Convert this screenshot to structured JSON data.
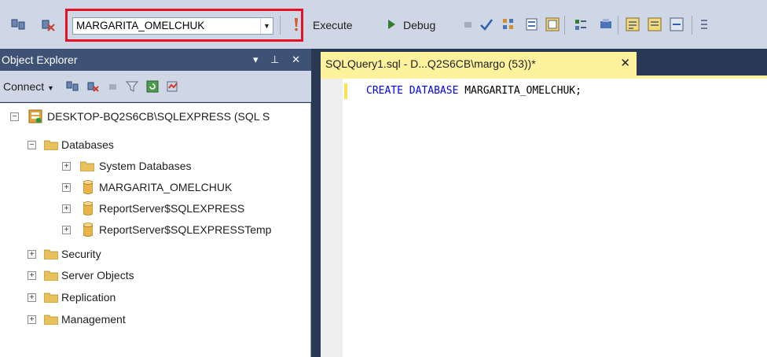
{
  "toolbar": {
    "database_selector": {
      "value": "MARGARITA_OMELCHUK"
    },
    "execute_label": "Execute",
    "debug_label": "Debug"
  },
  "object_explorer": {
    "title": "Object Explorer",
    "header_controls": "▾ ⊥ ✕",
    "connect_label": "Connect",
    "tree": [
      {
        "label": "DESKTOP-BQ2S6CB\\SQLEXPRESS (SQL S",
        "icon": "server-icon",
        "expanded": true
      },
      {
        "label": "Databases",
        "icon": "folder-icon",
        "expanded": true
      },
      {
        "label": "System Databases",
        "icon": "folder-icon",
        "expanded": false
      },
      {
        "label": "MARGARITA_OMELCHUK",
        "icon": "database-icon",
        "expanded": false
      },
      {
        "label": "ReportServer$SQLEXPRESS",
        "icon": "database-icon",
        "expanded": false
      },
      {
        "label": "ReportServer$SQLEXPRESSTemp",
        "icon": "database-icon",
        "expanded": false
      },
      {
        "label": "Security",
        "icon": "folder-icon",
        "expanded": false
      },
      {
        "label": "Server Objects",
        "icon": "folder-icon",
        "expanded": false
      },
      {
        "label": "Replication",
        "icon": "folder-icon",
        "expanded": false
      },
      {
        "label": "Management",
        "icon": "folder-icon",
        "expanded": false
      }
    ]
  },
  "editor": {
    "tab_title": "SQLQuery1.sql - D...Q2S6CB\\margo (53))*",
    "tab_close": "✕",
    "code": {
      "keyword": "CREATE DATABASE",
      "identifier": "MARGARITA_OMELCHUK",
      "terminator": ";"
    }
  },
  "colors": {
    "highlight_border": "#e81123",
    "active_tab": "#fff29d",
    "sql_keyword": "#0000ff",
    "panel_header": "#3e5275",
    "toolbar_bg": "#cfd6e5"
  }
}
